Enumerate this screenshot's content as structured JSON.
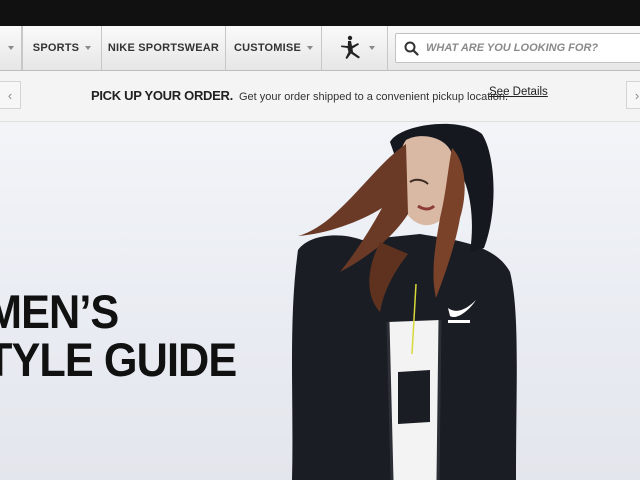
{
  "nav": {
    "items": [
      {
        "label": "SPORTS"
      },
      {
        "label": "NIKE SPORTSWEAR"
      },
      {
        "label": "CUSTOMISE"
      }
    ]
  },
  "search": {
    "placeholder": "WHAT ARE YOU LOOKING FOR?"
  },
  "promo": {
    "heading": "PICK UP YOUR ORDER.",
    "body": "Get your order shipped to a convenient pickup location.",
    "link": "See Details"
  },
  "hero": {
    "title_line1": "MEN’S",
    "title_line2": "TYLE GUIDE"
  },
  "icons": {
    "jordan": "jumpman-logo-icon",
    "search": "search-icon",
    "prev": "chevron-left-icon",
    "next": "chevron-right-icon"
  }
}
